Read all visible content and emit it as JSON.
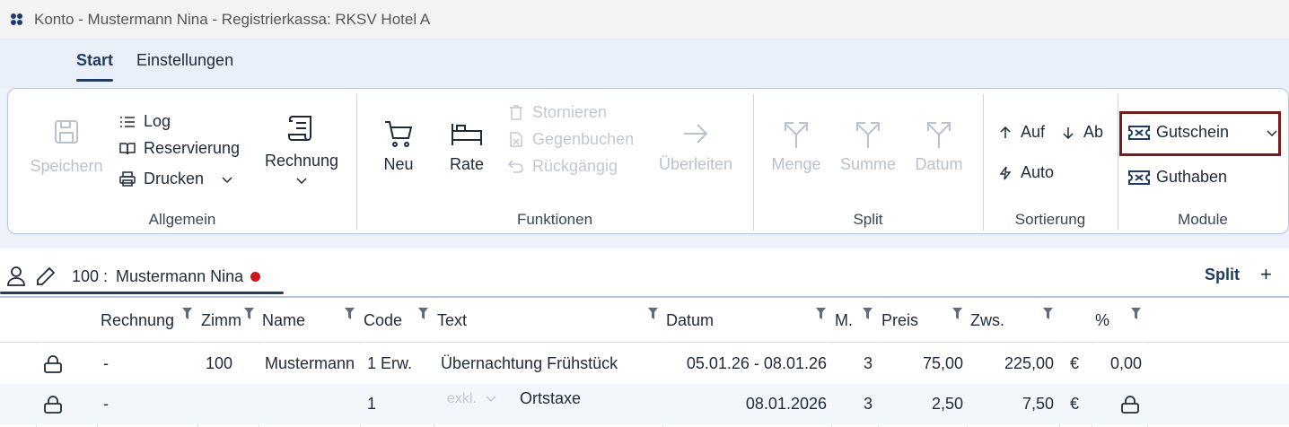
{
  "window": {
    "title": "Konto - Mustermann Nina - Registrierkassa: RKSV Hotel A"
  },
  "menu_tabs": [
    {
      "label": "Start",
      "active": true
    },
    {
      "label": "Einstellungen",
      "active": false
    }
  ],
  "ribbon": {
    "allgemein": {
      "label": "Allgemein",
      "speichern": "Speichern",
      "log": "Log",
      "reservierung": "Reservierung",
      "drucken": "Drucken",
      "rechnung": "Rechnung"
    },
    "funktionen": {
      "label": "Funktionen",
      "neu": "Neu",
      "rate": "Rate",
      "stornieren": "Stornieren",
      "gegenbuchen": "Gegenbuchen",
      "rueckgaengig": "Rückgängig",
      "ueberleiten": "Überleiten"
    },
    "split": {
      "label": "Split",
      "menge": "Menge",
      "summe": "Summe",
      "datum": "Datum"
    },
    "sortierung": {
      "label": "Sortierung",
      "auf": "Auf",
      "ab": "Ab",
      "auto": "Auto"
    },
    "module": {
      "label": "Module",
      "gutschein": "Gutschein",
      "guthaben": "Guthaben"
    }
  },
  "account_tab": {
    "number": "100 :",
    "name": "Mustermann Nina",
    "status_color": "#d0151b",
    "split_label": "Split",
    "add_label": "+"
  },
  "table": {
    "headers": [
      "Rechnung",
      "Zimm",
      "Name",
      "Code",
      "Text",
      "Datum",
      "M.",
      "Preis",
      "Zws.",
      "%"
    ],
    "rows": [
      {
        "locked": true,
        "rechnung": "-",
        "zimmer": "100",
        "name": "Mustermann",
        "code": "1 Erw.",
        "tax_mode": "",
        "text": "Übernachtung Frühstück",
        "datum": "05.01.26 - 08.01.26",
        "menge": "3",
        "preis": "75,00",
        "zws": "225,00",
        "currency": "€",
        "percent": "0,00",
        "percent_locked": false
      },
      {
        "locked": true,
        "rechnung": "-",
        "zimmer": "",
        "name": "",
        "code": "1",
        "tax_mode": "exkl.",
        "text": "Ortstaxe",
        "datum": "08.01.2026",
        "menge": "3",
        "preis": "2,50",
        "zws": "7,50",
        "currency": "€",
        "percent": "",
        "percent_locked": true
      }
    ]
  },
  "colors": {
    "accent": "#1f3b66",
    "highlight_border": "#7a1a1a",
    "ribbon_bg": "#eaf0fa",
    "row_alt": "#f3f6fb"
  }
}
